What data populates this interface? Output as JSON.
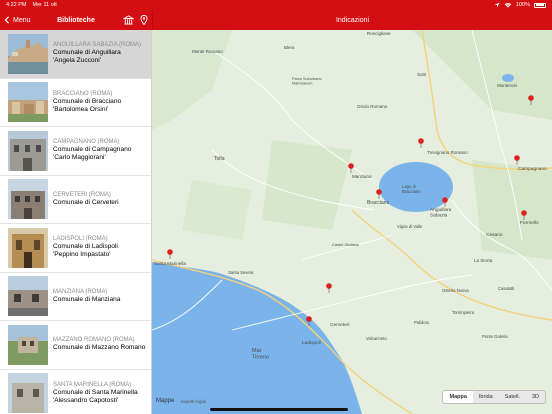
{
  "status": {
    "time": "4:22 PM",
    "date": "Mer 11 ott",
    "battery": "100%"
  },
  "sidebar": {
    "back_label": "Menu",
    "title": "Biblioteche",
    "items": [
      {
        "city": "ANGUILLARA SABAZIA (ROMA)",
        "line1": "Comunale di Anguillara",
        "line2": "'Angela Zucconi'"
      },
      {
        "city": "BRACCIANO (ROMA)",
        "line1": "Comunale di Bracciano",
        "line2": "'Bartolomea Orsini'"
      },
      {
        "city": "CAMPAGNANO (ROMA)",
        "line1": "Comunale di Campagnano",
        "line2": "'Carlo Maggiorani'"
      },
      {
        "city": "CERVETERI (ROMA)",
        "line1": "Comunale di Cerveteri",
        "line2": ""
      },
      {
        "city": "LADISPOLI (ROMA)",
        "line1": "Comunale di Ladispoli",
        "line2": "'Peppino Impastato'"
      },
      {
        "city": "MANZIANA (ROMA)",
        "line1": "Comunale di Manziana",
        "line2": ""
      },
      {
        "city": "MAZZANO ROMANO (ROMA)",
        "line1": "Comunale di Mazzano Romano",
        "line2": ""
      },
      {
        "city": "SANTA MARINELLA (ROMA)",
        "line1": "Comunale di Santa Marinella",
        "line2": "'Alessandro Capotosti'"
      }
    ]
  },
  "map": {
    "title": "Indicazioni",
    "lake_label": "Lago di\nBracciano",
    "sea_label": "Mar\nTirreno",
    "place_labels": {
      "ronciglione": "Ronciglione",
      "monte_romano": "Monte Romano",
      "blera": "Blera",
      "parco": "Parco Suburbano\nMarturanum",
      "sutri": "Sutri",
      "monterosi": "Monterosi",
      "oriolo": "Oriolo Romano",
      "trevignano": "Trevignano Romano",
      "tolfa": "Tolfa",
      "manziana": "Manziana",
      "bracciano": "Bracciano",
      "anguillara": "Anguillara\nSabazia",
      "campagnano": "Campagnano",
      "formello": "Formello",
      "cesano": "Cesano",
      "vigna": "Vigna di Valle",
      "la_storta": "La Storta",
      "castel_giuliano": "Castel Giuliano",
      "santa_marinella": "Santa Marinella",
      "santa_severa": "Santa Severa",
      "cerveteri": "Cerveteri",
      "ladispoli": "Ladispoli",
      "valcanneto": "Valcanneto",
      "palidoro": "Palidoro",
      "torrimpietra": "Torrimpietra",
      "ostia_antica": "Osteria Nuova",
      "casal": "Casalotti",
      "ponte": "Ponte Galeria"
    },
    "legal": "Mappe",
    "legal2": "Aspetti legali",
    "modes": [
      "Mappa",
      "Ibrida",
      "Satell.",
      "3D"
    ]
  },
  "colors": {
    "accent": "#d40f14",
    "land": "#e6efe0",
    "water": "#7ab4ea",
    "pin": "#d9211f"
  }
}
